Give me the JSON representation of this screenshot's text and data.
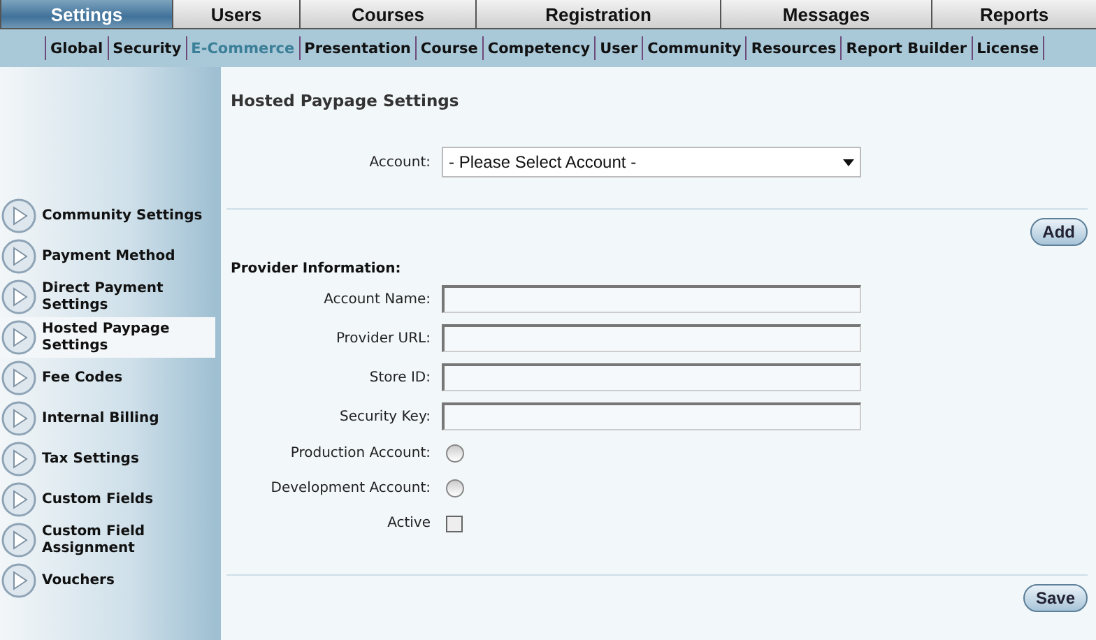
{
  "main_tabs": [
    {
      "label": "Settings",
      "selected": true
    },
    {
      "label": "Users",
      "selected": false
    },
    {
      "label": "Courses",
      "selected": false
    },
    {
      "label": "Registration",
      "selected": false
    },
    {
      "label": "Messages",
      "selected": false
    },
    {
      "label": "Reports",
      "selected": false
    }
  ],
  "sub_tabs": [
    {
      "label": "Global",
      "selected": false
    },
    {
      "label": "Security",
      "selected": false
    },
    {
      "label": "E-Commerce",
      "selected": true
    },
    {
      "label": "Presentation",
      "selected": false
    },
    {
      "label": "Course",
      "selected": false
    },
    {
      "label": "Competency",
      "selected": false
    },
    {
      "label": "User",
      "selected": false
    },
    {
      "label": "Community",
      "selected": false
    },
    {
      "label": "Resources",
      "selected": false
    },
    {
      "label": "Report Builder",
      "selected": false
    },
    {
      "label": "License",
      "selected": false
    }
  ],
  "sidebar": {
    "items": [
      {
        "label": "Community Settings",
        "selected": false
      },
      {
        "label": "Payment Method",
        "selected": false
      },
      {
        "label": "Direct Payment Settings",
        "selected": false
      },
      {
        "label": "Hosted Paypage Settings",
        "selected": true
      },
      {
        "label": "Fee Codes",
        "selected": false
      },
      {
        "label": "Internal Billing",
        "selected": false
      },
      {
        "label": "Tax Settings",
        "selected": false
      },
      {
        "label": "Custom Fields",
        "selected": false
      },
      {
        "label": "Custom Field Assignment",
        "selected": false
      },
      {
        "label": "Vouchers",
        "selected": false
      }
    ]
  },
  "page_title": "Hosted Paypage Settings",
  "account": {
    "label": "Account:",
    "value": "- Please Select Account -"
  },
  "add_button": "Add",
  "section_title": "Provider Information:",
  "fields": [
    {
      "kind": "text",
      "label": "Account Name:"
    },
    {
      "kind": "text",
      "label": "Provider URL:"
    },
    {
      "kind": "text",
      "label": "Store ID:"
    },
    {
      "kind": "text",
      "label": "Security Key:"
    },
    {
      "kind": "radio",
      "label": "Production Account:",
      "checked": false
    },
    {
      "kind": "radio",
      "label": "Development Account:",
      "checked": false
    },
    {
      "kind": "checkbox",
      "label": "Active",
      "checked": false
    }
  ],
  "save_button": "Save"
}
